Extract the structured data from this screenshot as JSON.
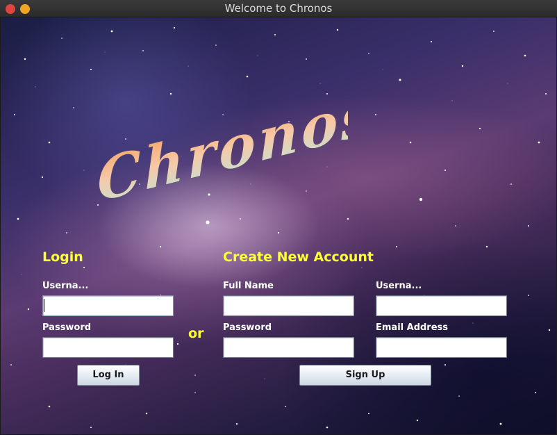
{
  "window": {
    "title": "Welcome to Chronos",
    "close_color": "#e0443e",
    "minimize_color": "#f0a624"
  },
  "logo": {
    "text": "Chronos"
  },
  "login": {
    "heading": "Login",
    "username_label": "Userna...",
    "username_value": "",
    "password_label": "Password",
    "password_value": "",
    "button_label": "Log In"
  },
  "separator": {
    "text": "or"
  },
  "signup": {
    "heading": "Create New Account",
    "fullname_label": "Full Name",
    "fullname_value": "",
    "username_label": "Userna...",
    "username_value": "",
    "password_label": "Password",
    "password_value": "",
    "email_label": "Email Address",
    "email_value": "",
    "button_label": "Sign Up"
  },
  "colors": {
    "heading": "#ffff33",
    "label": "#ffffff"
  }
}
